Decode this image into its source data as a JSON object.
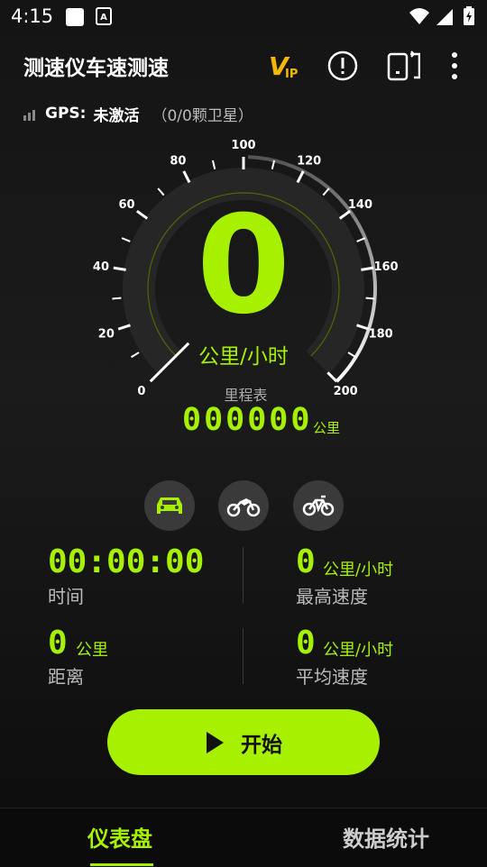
{
  "status_bar": {
    "time": "4:15",
    "icons": [
      "square-notification-icon",
      "a-notification-icon",
      "wifi-icon",
      "signal-icon",
      "battery-icon"
    ]
  },
  "app_bar": {
    "title": "测速仪车速测速",
    "vip_text": "V",
    "vip_sub": "IP",
    "actions": [
      "vip-icon",
      "info-icon",
      "rotate-screen-icon",
      "more-vert-icon"
    ]
  },
  "gps": {
    "label": "GPS:",
    "status": "未激活",
    "satellites": "（0/0颗卫星）"
  },
  "gauge": {
    "min": 0,
    "max": 200,
    "tick_labels": [
      "0",
      "20",
      "40",
      "60",
      "80",
      "100",
      "120",
      "140",
      "160",
      "180",
      "200"
    ],
    "current_speed": "0",
    "speed_unit": "公里/小时",
    "odometer_label": "里程表",
    "odometer_value": "000000",
    "odometer_unit": "公里"
  },
  "vehicles": {
    "options": [
      "car-icon",
      "motorcycle-icon",
      "bicycle-icon"
    ],
    "selected": "car-icon"
  },
  "stats": {
    "time": {
      "value": "00:00:00",
      "label": "时间"
    },
    "max_speed": {
      "value": "0",
      "unit": "公里/小时",
      "label": "最高速度"
    },
    "distance": {
      "value": "0",
      "unit": "公里",
      "label": "距离"
    },
    "avg_speed": {
      "value": "0",
      "unit": "公里/小时",
      "label": "平均速度"
    }
  },
  "start_button": {
    "label": "开始"
  },
  "bottom_nav": {
    "tabs": [
      {
        "label": "仪表盘",
        "active": true
      },
      {
        "label": "数据统计",
        "active": false
      }
    ]
  },
  "colors": {
    "accent": "#a6f000",
    "background": "#141414",
    "button_gray": "#3a3a3a"
  }
}
